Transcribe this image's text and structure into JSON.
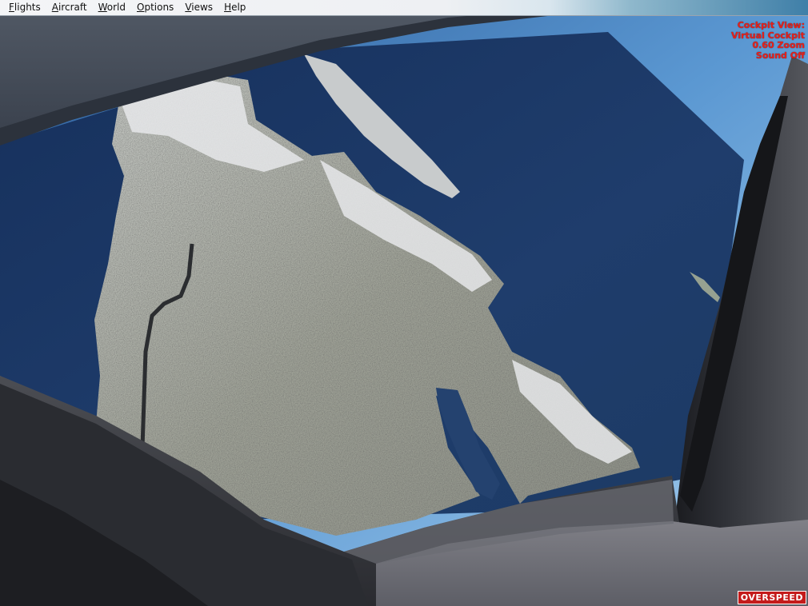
{
  "menu": {
    "items": [
      {
        "label": "Flights"
      },
      {
        "label": "Aircraft"
      },
      {
        "label": "World"
      },
      {
        "label": "Options"
      },
      {
        "label": "Views"
      },
      {
        "label": "Help"
      }
    ]
  },
  "view_info": {
    "line1": "Cockpit View:",
    "line2": "Virtual Cockpit",
    "line3": "0.60 Zoom",
    "line4": "Sound Off",
    "color": "#e8201a"
  },
  "warning": {
    "label": "OVERSPEED",
    "background": "#c41b1b"
  },
  "colors": {
    "sea": "#1d3560",
    "sky": "#5f9ed6",
    "land": "#a3a59c",
    "frame": "#3c3f46"
  }
}
